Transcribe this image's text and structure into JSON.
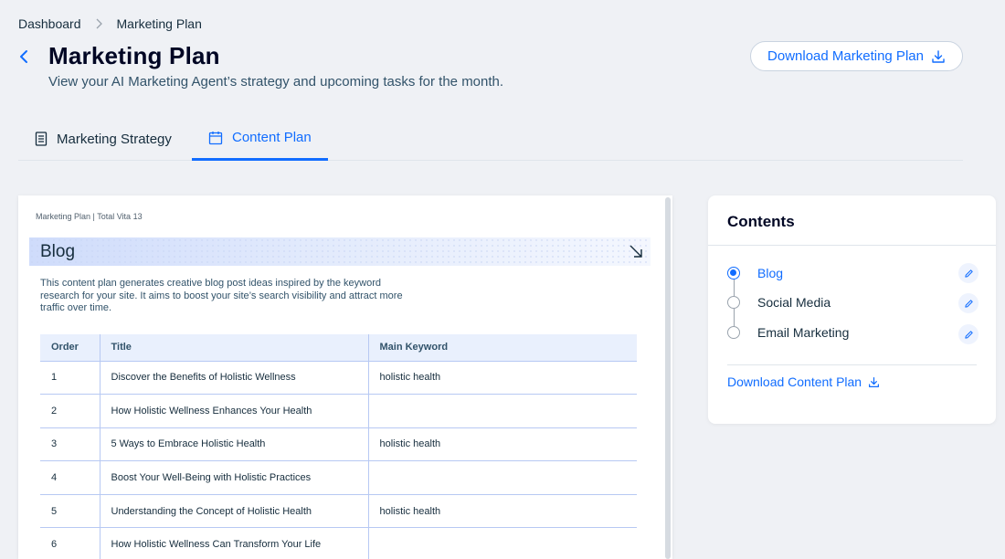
{
  "breadcrumb": {
    "root": "Dashboard",
    "current": "Marketing Plan"
  },
  "header": {
    "title": "Marketing Plan",
    "subtitle": "View your AI Marketing Agent’s strategy and upcoming tasks for the month.",
    "download_label": "Download Marketing Plan"
  },
  "tabs": [
    {
      "label": "Marketing Strategy",
      "icon": "document-icon",
      "active": false
    },
    {
      "label": "Content Plan",
      "icon": "calendar-icon",
      "active": true
    }
  ],
  "document": {
    "caption": "Marketing Plan | Total Vita 13",
    "section_title": "Blog",
    "description": "This content plan generates creative blog post ideas inspired by the keyword research for your site. It aims to boost your site’s search visibility and attract more traffic over time.",
    "columns": [
      "Order",
      "Title",
      "Main Keyword"
    ],
    "rows": [
      {
        "order": "1",
        "title": "Discover the Benefits of Holistic Wellness",
        "keyword": "holistic health"
      },
      {
        "order": "2",
        "title": "How Holistic Wellness Enhances Your Health",
        "keyword": ""
      },
      {
        "order": "3",
        "title": "5 Ways to Embrace Holistic Health",
        "keyword": "holistic health"
      },
      {
        "order": "4",
        "title": "Boost Your Well-Being with Holistic Practices",
        "keyword": ""
      },
      {
        "order": "5",
        "title": "Understanding the Concept of Holistic Health",
        "keyword": "holistic health"
      },
      {
        "order": "6",
        "title": "How Holistic Wellness Can Transform Your Life",
        "keyword": ""
      }
    ]
  },
  "contents": {
    "title": "Contents",
    "items": [
      {
        "label": "Blog",
        "selected": true
      },
      {
        "label": "Social Media",
        "selected": false
      },
      {
        "label": "Email Marketing",
        "selected": false
      }
    ],
    "download_label": "Download Content Plan"
  },
  "colors": {
    "accent": "#116dff",
    "text": "#162d3d",
    "background": "#eff1f5"
  }
}
